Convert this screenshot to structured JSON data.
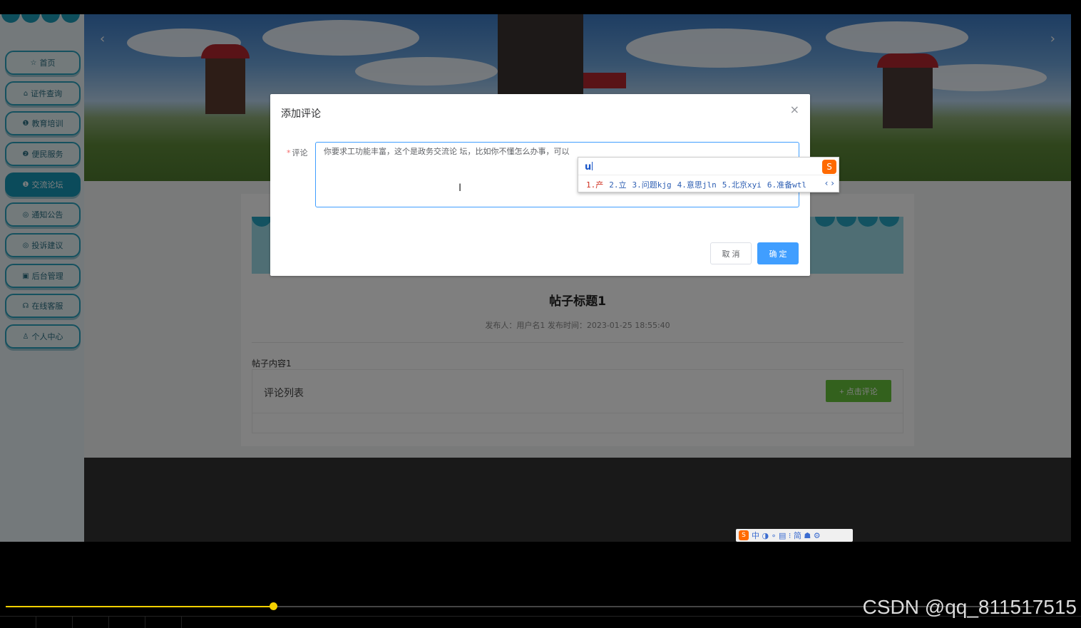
{
  "sidebar": {
    "items": [
      {
        "icon": "☆",
        "label": "首页",
        "active": false
      },
      {
        "icon": "⌂",
        "label": "证件查询",
        "active": false
      },
      {
        "icon": "❶",
        "label": "教育培训",
        "active": false
      },
      {
        "icon": "❷",
        "label": "便民服务",
        "active": false
      },
      {
        "icon": "❶",
        "label": "交流论坛",
        "active": true
      },
      {
        "icon": "◎",
        "label": "通知公告",
        "active": false
      },
      {
        "icon": "◎",
        "label": "投诉建议",
        "active": false
      },
      {
        "icon": "▣",
        "label": "后台管理",
        "active": false
      },
      {
        "icon": "☊",
        "label": "在线客服",
        "active": false
      },
      {
        "icon": "♙",
        "label": "个人中心",
        "active": false
      }
    ]
  },
  "banner": {
    "prev": "‹",
    "next": "›"
  },
  "post": {
    "title": "帖子标题1",
    "meta": "发布人：用户名1  发布时间：2023-01-25 18:55:40",
    "body": "帖子内容1",
    "comments_header": "评论列表",
    "comment_button": "+ 点击评论"
  },
  "dialog": {
    "title": "添加评论",
    "close": "×",
    "label_required": "*",
    "label": "评论",
    "textarea_value": "你要求工功能丰富，这个是政务交流论 坛，比如你不懂怎么办事，可以",
    "cancel": "取 消",
    "ok": "确 定"
  },
  "ime": {
    "composition": "u",
    "candidates": [
      "1.产",
      "2.立",
      "3.问题kjg",
      "4.意思jln",
      "5.北京xyi",
      "6.准备wtl"
    ],
    "nav": "‹ ›",
    "logo": "S",
    "status_bar": "中 ◑ ∘ ▤ ⁝ 简 ☗ ⚙"
  },
  "player": {
    "progress": 0.26,
    "watermark": "CSDN @qq_811517515"
  }
}
